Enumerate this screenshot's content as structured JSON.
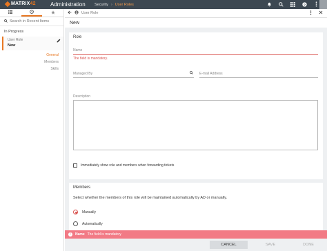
{
  "topbar": {
    "logo_main": "MATRIX",
    "logo_accent": "42",
    "app_title": "Administration",
    "breadcrumb": [
      "Security",
      "User Roles"
    ],
    "icons": [
      "bell-icon",
      "search-icon",
      "grid-icon",
      "help-icon",
      "more-icon"
    ]
  },
  "left": {
    "tabs": [
      "list-icon",
      "history-icon",
      "star-icon"
    ],
    "search_placeholder": "Search in Recent Items",
    "section_title": "In Progress",
    "recent_item": {
      "type": "User Role",
      "name": "New"
    },
    "subnav": [
      "General",
      "Members",
      "Skills"
    ]
  },
  "main": {
    "breadcrumb": "User Role",
    "title": "New"
  },
  "role_card": {
    "title": "Role",
    "name_label": "Name",
    "name_error": "The field is mandatory.",
    "managed_by_label": "Managed By",
    "email_label": "E-mail Address",
    "description_label": "Description",
    "checkbox_label": "Immediately show role and members when forwarding tickets"
  },
  "members_card": {
    "title": "Members",
    "description": "Select whether the members of this role will be maintained automatically by AD or manually.",
    "options": [
      "Manually",
      "Automatically"
    ],
    "selected": "Manually"
  },
  "error_bar": {
    "field": "Name",
    "message": "The field is mandatory"
  },
  "footer": {
    "cancel": "CANCEL",
    "save": "SAVE",
    "done": "DONE"
  },
  "colors": {
    "accent": "#e87722",
    "error": "#d9534f",
    "topbar": "#3d4852"
  }
}
